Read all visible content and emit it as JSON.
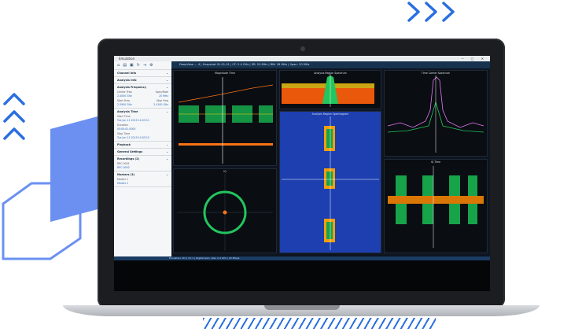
{
  "app": {
    "title": "Emulation",
    "header": "DeepView — 4 | Snapshot 01-01-01 | CF: 2.4 GHz | SR: 20 MHz | BW: 18 MHz | Span: 20 MHz",
    "status": "Emulation Ctrl | Ch 1 | Digital Gain | Rec 2.4 GHz | 20 MSa/s"
  },
  "toolbar": {
    "icons": [
      "home-icon",
      "folder-icon",
      "save-icon",
      "refresh-icon",
      "export-icon",
      "settings-icon"
    ]
  },
  "sidebar": {
    "sections": [
      {
        "title": "Channel Info"
      },
      {
        "title": "Analysis Info"
      },
      {
        "title": "Analysis Frequency",
        "rows": [
          [
            "Center Freq",
            "Span/Rate"
          ],
          [
            "2.4000 GHz",
            "20 MHz"
          ],
          [
            "Start Freq",
            "Stop Freq"
          ],
          [
            "2.3900 GHz",
            "2.4100 GHz"
          ]
        ]
      },
      {
        "title": "Analysis Time",
        "rows": [
          [
            "Start Time",
            ""
          ],
          [
            "Tue Jun 11 2019 14:03:11",
            ""
          ],
          [
            "Duration",
            ""
          ],
          [
            "00:00:01.0000",
            ""
          ],
          [
            "Stop Time",
            ""
          ],
          [
            "Tue Jun 11 2019 14:03:12",
            ""
          ]
        ]
      },
      {
        "title": "Playback"
      },
      {
        "title": "General Settings"
      },
      {
        "title": "Recordings (2)",
        "rows": [
          [
            "REC-0001",
            ""
          ],
          [
            "REC-0002",
            ""
          ]
        ]
      },
      {
        "title": "Markers (3)",
        "rows": [
          [
            "Marker 1",
            ""
          ],
          [
            "Marker 2",
            ""
          ]
        ]
      }
    ]
  },
  "panels": {
    "magnitude": "Magnitude Time",
    "spectrum": "Analysis Region Spectrum",
    "spectrogram": "Analysis Region Spectrogram",
    "tcs": "Time Carrier Spectrum",
    "iq": "IQ",
    "td": "IQ Time"
  },
  "colors": {
    "blue": "#2a6fe0",
    "green": "#22c55e",
    "orange": "#f97316"
  }
}
